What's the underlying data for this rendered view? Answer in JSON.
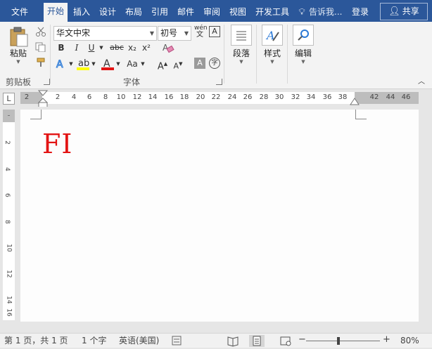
{
  "tabs": [
    {
      "label": "文件",
      "active": false
    },
    {
      "label": "开始",
      "active": true
    },
    {
      "label": "插入",
      "active": false
    },
    {
      "label": "设计",
      "active": false
    },
    {
      "label": "布局",
      "active": false
    },
    {
      "label": "引用",
      "active": false
    },
    {
      "label": "邮件",
      "active": false
    },
    {
      "label": "审阅",
      "active": false
    },
    {
      "label": "视图",
      "active": false
    },
    {
      "label": "开发工具",
      "active": false
    }
  ],
  "tell_me": "告诉我...",
  "login": "登录",
  "share": "共享",
  "clipboard": {
    "paste_label": "粘贴",
    "group_label": "剪贴板"
  },
  "font": {
    "font_name": "华文中宋",
    "font_size": "初号",
    "bold": "B",
    "italic": "I",
    "underline": "U",
    "strikethrough": "abc",
    "subscript": "x₂",
    "superscript": "x²",
    "change_case": "Aa",
    "grow": "A",
    "shrink": "A",
    "phonetic": "wén",
    "enclose": "字",
    "group_label": "字体"
  },
  "paragraph": {
    "label": "段落"
  },
  "styles": {
    "label": "样式"
  },
  "editing": {
    "label": "编辑"
  },
  "ruler": {
    "corner": "L",
    "numbers": [
      "2",
      "2",
      "4",
      "6",
      "8",
      "10",
      "12",
      "14",
      "16",
      "18",
      "20",
      "22",
      "24",
      "26",
      "28",
      "30",
      "32",
      "34",
      "36",
      "38",
      "42",
      "44",
      "46"
    ],
    "vnumbers": [
      "2",
      "4",
      "6",
      "8",
      "10",
      "12",
      "14",
      "16"
    ]
  },
  "document": {
    "text": "FI"
  },
  "status": {
    "page": "第 1 页，共 1 页",
    "words": "1 个字",
    "language": "英语(美国)",
    "zoom": "80%"
  },
  "colors": {
    "accent": "#2b579a",
    "doc_text": "#e31414",
    "font_color_bar": "#e31414",
    "highlight_bar": "#ffff00"
  }
}
